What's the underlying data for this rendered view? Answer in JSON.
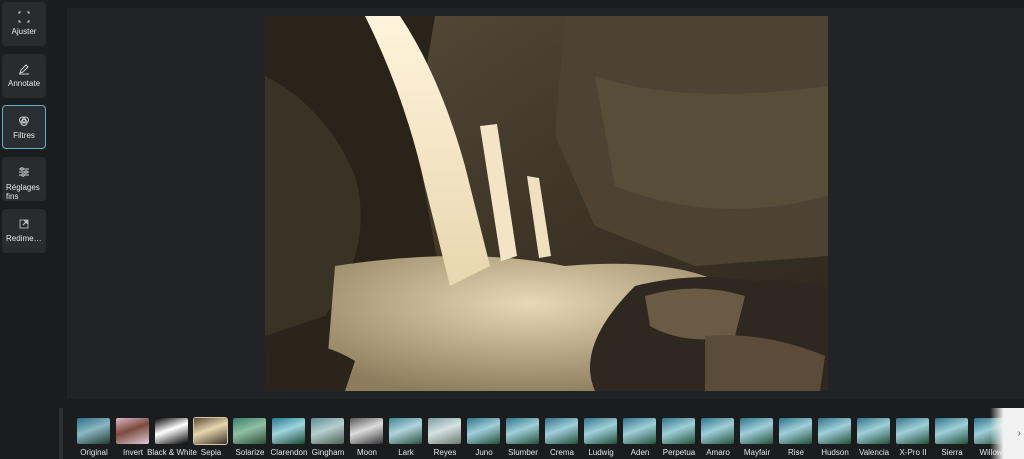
{
  "sidebar": {
    "items": [
      {
        "label": "Ajuster",
        "icon": "crop-icon"
      },
      {
        "label": "Annotate",
        "icon": "edit-icon"
      },
      {
        "label": "Filtres",
        "icon": "filter-icon"
      },
      {
        "label": "Réglages fins",
        "icon": "sliders-icon"
      },
      {
        "label": "Redimensionner",
        "icon": "resize-icon"
      }
    ]
  },
  "filters": {
    "selected": "Sepia",
    "items": [
      "Original",
      "Invert",
      "Black & White",
      "Sepia",
      "Solarize",
      "Clarendon",
      "Gingham",
      "Moon",
      "Lark",
      "Reyes",
      "Juno",
      "Slumber",
      "Crema",
      "Ludwig",
      "Aden",
      "Perpetua",
      "Amaro",
      "Mayfair",
      "Rise",
      "Hudson",
      "Valencia",
      "X-Pro II",
      "Sierra",
      "Willow"
    ]
  },
  "colors": {
    "accent": "#5ab3c6",
    "background": "#1b1c1e",
    "panel": "#222326"
  }
}
